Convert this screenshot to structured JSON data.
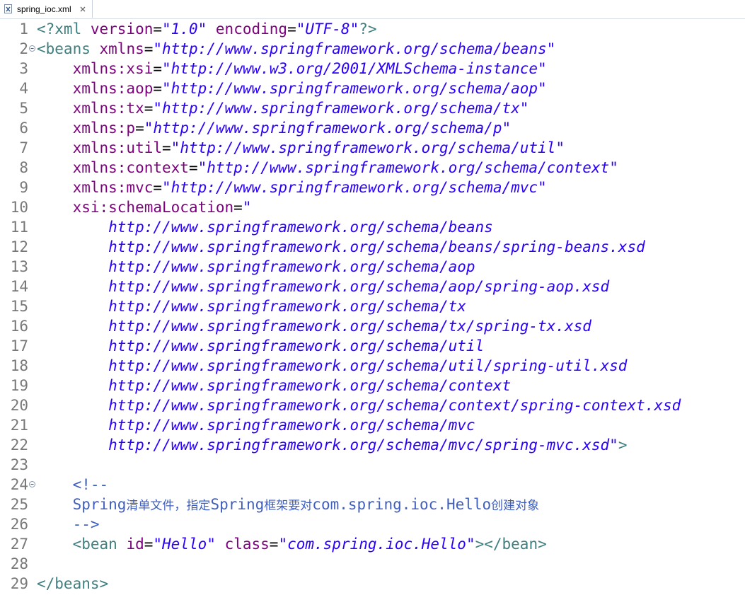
{
  "tab": {
    "title": "spring_ioc.xml",
    "file_icon": "xml-file-icon",
    "close_icon": "close-icon"
  },
  "colors": {
    "tag": "#3f7f7f",
    "attribute": "#7f007f",
    "value": "#2a00ff",
    "comment": "#3f5fbf",
    "line_number": "#787878"
  },
  "lines": [
    {
      "n": "1",
      "fold": false,
      "tokens": [
        {
          "t": "tag",
          "v": "<?xml "
        },
        {
          "t": "attr",
          "v": "version"
        },
        {
          "t": "eq",
          "v": "="
        },
        {
          "t": "val",
          "v": "\"1.0\""
        },
        {
          "t": "eq",
          "v": " "
        },
        {
          "t": "attr",
          "v": "encoding"
        },
        {
          "t": "eq",
          "v": "="
        },
        {
          "t": "val",
          "v": "\"UTF-8\""
        },
        {
          "t": "tag",
          "v": "?>"
        }
      ]
    },
    {
      "n": "2",
      "fold": true,
      "tokens": [
        {
          "t": "tag",
          "v": "<beans "
        },
        {
          "t": "attr",
          "v": "xmlns"
        },
        {
          "t": "eq",
          "v": "="
        },
        {
          "t": "val",
          "v": "\"http://www.springframework.org/schema/beans\""
        }
      ]
    },
    {
      "n": "3",
      "fold": false,
      "tokens": [
        {
          "t": "eq",
          "v": "    "
        },
        {
          "t": "attr",
          "v": "xmlns:xsi"
        },
        {
          "t": "eq",
          "v": "="
        },
        {
          "t": "val",
          "v": "\"http://www.w3.org/2001/XMLSchema-instance\""
        }
      ]
    },
    {
      "n": "4",
      "fold": false,
      "tokens": [
        {
          "t": "eq",
          "v": "    "
        },
        {
          "t": "attr",
          "v": "xmlns:aop"
        },
        {
          "t": "eq",
          "v": "="
        },
        {
          "t": "val",
          "v": "\"http://www.springframework.org/schema/aop\""
        }
      ]
    },
    {
      "n": "5",
      "fold": false,
      "tokens": [
        {
          "t": "eq",
          "v": "    "
        },
        {
          "t": "attr",
          "v": "xmlns:tx"
        },
        {
          "t": "eq",
          "v": "="
        },
        {
          "t": "val",
          "v": "\"http://www.springframework.org/schema/tx\""
        }
      ]
    },
    {
      "n": "6",
      "fold": false,
      "tokens": [
        {
          "t": "eq",
          "v": "    "
        },
        {
          "t": "attr",
          "v": "xmlns:p"
        },
        {
          "t": "eq",
          "v": "="
        },
        {
          "t": "val",
          "v": "\"http://www.springframework.org/schema/p\""
        }
      ]
    },
    {
      "n": "7",
      "fold": false,
      "tokens": [
        {
          "t": "eq",
          "v": "    "
        },
        {
          "t": "attr",
          "v": "xmlns:util"
        },
        {
          "t": "eq",
          "v": "="
        },
        {
          "t": "val",
          "v": "\"http://www.springframework.org/schema/util\""
        }
      ]
    },
    {
      "n": "8",
      "fold": false,
      "tokens": [
        {
          "t": "eq",
          "v": "    "
        },
        {
          "t": "attr",
          "v": "xmlns:context"
        },
        {
          "t": "eq",
          "v": "="
        },
        {
          "t": "val",
          "v": "\"http://www.springframework.org/schema/context\""
        }
      ]
    },
    {
      "n": "9",
      "fold": false,
      "tokens": [
        {
          "t": "eq",
          "v": "    "
        },
        {
          "t": "attr",
          "v": "xmlns:mvc"
        },
        {
          "t": "eq",
          "v": "="
        },
        {
          "t": "val",
          "v": "\"http://www.springframework.org/schema/mvc\""
        }
      ]
    },
    {
      "n": "10",
      "fold": false,
      "tokens": [
        {
          "t": "eq",
          "v": "    "
        },
        {
          "t": "attr",
          "v": "xsi:schemaLocation"
        },
        {
          "t": "eq",
          "v": "="
        },
        {
          "t": "val",
          "v": "\""
        }
      ]
    },
    {
      "n": "11",
      "fold": false,
      "tokens": [
        {
          "t": "val",
          "v": "        http://www.springframework.org/schema/beans"
        }
      ]
    },
    {
      "n": "12",
      "fold": false,
      "tokens": [
        {
          "t": "val",
          "v": "        http://www.springframework.org/schema/beans/spring-beans.xsd"
        }
      ]
    },
    {
      "n": "13",
      "fold": false,
      "tokens": [
        {
          "t": "val",
          "v": "        http://www.springframework.org/schema/aop"
        }
      ]
    },
    {
      "n": "14",
      "fold": false,
      "tokens": [
        {
          "t": "val",
          "v": "        http://www.springframework.org/schema/aop/spring-aop.xsd"
        }
      ]
    },
    {
      "n": "15",
      "fold": false,
      "tokens": [
        {
          "t": "val",
          "v": "        http://www.springframework.org/schema/tx"
        }
      ]
    },
    {
      "n": "16",
      "fold": false,
      "tokens": [
        {
          "t": "val",
          "v": "        http://www.springframework.org/schema/tx/spring-tx.xsd"
        }
      ]
    },
    {
      "n": "17",
      "fold": false,
      "tokens": [
        {
          "t": "val",
          "v": "        http://www.springframework.org/schema/util"
        }
      ]
    },
    {
      "n": "18",
      "fold": false,
      "tokens": [
        {
          "t": "val",
          "v": "        http://www.springframework.org/schema/util/spring-util.xsd"
        }
      ]
    },
    {
      "n": "19",
      "fold": false,
      "tokens": [
        {
          "t": "val",
          "v": "        http://www.springframework.org/schema/context"
        }
      ]
    },
    {
      "n": "20",
      "fold": false,
      "tokens": [
        {
          "t": "val",
          "v": "        http://www.springframework.org/schema/context/spring-context.xsd"
        }
      ]
    },
    {
      "n": "21",
      "fold": false,
      "tokens": [
        {
          "t": "val",
          "v": "        http://www.springframework.org/schema/mvc"
        }
      ]
    },
    {
      "n": "22",
      "fold": false,
      "tokens": [
        {
          "t": "val",
          "v": "        http://www.springframework.org/schema/mvc/spring-mvc.xsd\""
        },
        {
          "t": "tag",
          "v": ">"
        }
      ]
    },
    {
      "n": "23",
      "fold": false,
      "tokens": []
    },
    {
      "n": "24",
      "fold": true,
      "tokens": [
        {
          "t": "com",
          "v": "    <!--"
        }
      ]
    },
    {
      "n": "25",
      "fold": false,
      "tokens": [
        {
          "t": "com",
          "v": "    Spring"
        },
        {
          "t": "comcjk",
          "v": "清单文件，指定"
        },
        {
          "t": "com",
          "v": "Spring"
        },
        {
          "t": "comcjk",
          "v": "框架要对"
        },
        {
          "t": "com",
          "v": "com.spring.ioc.Hello"
        },
        {
          "t": "comcjk",
          "v": "创建对象"
        }
      ]
    },
    {
      "n": "26",
      "fold": false,
      "tokens": [
        {
          "t": "com",
          "v": "    -->"
        }
      ]
    },
    {
      "n": "27",
      "fold": false,
      "tokens": [
        {
          "t": "eq",
          "v": "    "
        },
        {
          "t": "tag",
          "v": "<bean "
        },
        {
          "t": "attr",
          "v": "id"
        },
        {
          "t": "eq",
          "v": "="
        },
        {
          "t": "val",
          "v": "\"Hello\""
        },
        {
          "t": "eq",
          "v": " "
        },
        {
          "t": "attr",
          "v": "class"
        },
        {
          "t": "eq",
          "v": "="
        },
        {
          "t": "val",
          "v": "\"com.spring.ioc.Hello\""
        },
        {
          "t": "tag",
          "v": "></bean>"
        }
      ]
    },
    {
      "n": "28",
      "fold": false,
      "tokens": []
    },
    {
      "n": "29",
      "fold": false,
      "tokens": [
        {
          "t": "tag",
          "v": "</beans>"
        }
      ]
    }
  ]
}
